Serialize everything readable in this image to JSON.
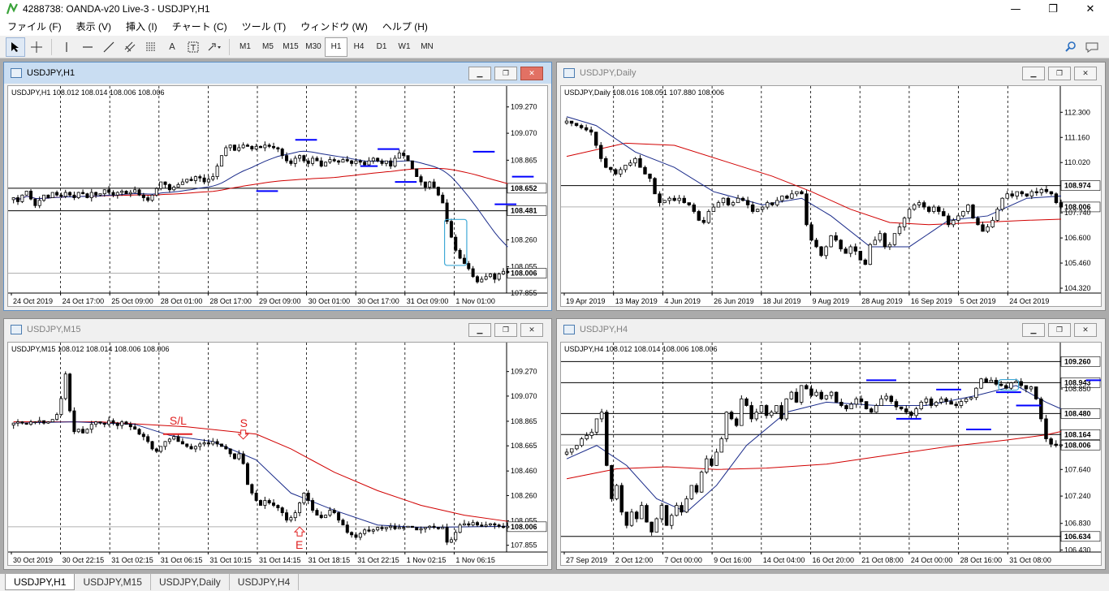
{
  "app": {
    "title": "4288738: OANDA-v20 Live-3 - USDJPY,H1",
    "controls": [
      "—",
      "❐",
      "✕"
    ]
  },
  "menu": [
    "ファイル (F)",
    "表示 (V)",
    "挿入 (I)",
    "チャート (C)",
    "ツール (T)",
    "ウィンドウ (W)",
    "ヘルプ (H)"
  ],
  "toolbar": {
    "tool_icons": [
      "cursor-icon",
      "crosshair-icon",
      "vertical-line-icon",
      "horizontal-line-icon",
      "trendline-icon",
      "fibonacci-icon",
      "channel-icon",
      "text-icon",
      "text-label-icon",
      "arrow-object-icon"
    ],
    "text_tool": "A",
    "label_tool": "T",
    "timeframes": [
      "M1",
      "M5",
      "M15",
      "M30",
      "H1",
      "H4",
      "D1",
      "W1",
      "MN"
    ],
    "selected_timeframe": "H1"
  },
  "colors": {
    "bull": "#ffffff",
    "bear": "#000000",
    "ma_fast": "#1a2b8a",
    "ma_slow": "#d10000",
    "level": "#0000ff",
    "cyan": "#3fa9d6",
    "annotation": "#e02020"
  },
  "windows": [
    {
      "key": "h1",
      "title": "USDJPY,H1",
      "ohlc": "USDJPY,H1  108.012 108.014 108.006 108.006",
      "active": true,
      "chart_data": {
        "type": "candlestick",
        "ylim": [
          107.855,
          109.33
        ],
        "y_ticks": [
          "109.270",
          "109.070",
          "108.865",
          "108.652",
          "108.481",
          "108.260",
          "108.055",
          "108.006",
          "107.855"
        ],
        "highlight_labels": [
          "108.652",
          "108.481",
          "108.006"
        ],
        "x_labels": [
          "24 Oct 2019",
          "24 Oct 17:00",
          "25 Oct 09:00",
          "28 Oct 01:00",
          "28 Oct 17:00",
          "29 Oct 09:00",
          "30 Oct 01:00",
          "30 Oct 17:00",
          "31 Oct 09:00",
          "1 Nov 01:00"
        ],
        "hlines": [
          108.652,
          108.481
        ],
        "last_price": 108.006,
        "closes": [
          108.58,
          108.55,
          108.6,
          108.63,
          108.57,
          108.52,
          108.56,
          108.6,
          108.58,
          108.62,
          108.6,
          108.59,
          108.62,
          108.6,
          108.58,
          108.62,
          108.61,
          108.58,
          108.62,
          108.6,
          108.61,
          108.64,
          108.62,
          108.6,
          108.62,
          108.63,
          108.61,
          108.62,
          108.64,
          108.6,
          108.58,
          108.56,
          108.6,
          108.65,
          108.7,
          108.68,
          108.64,
          108.66,
          108.68,
          108.7,
          108.72,
          108.71,
          108.74,
          108.73,
          108.7,
          108.72,
          108.74,
          108.82,
          108.9,
          108.96,
          108.98,
          108.94,
          108.96,
          108.98,
          108.97,
          108.95,
          108.97,
          108.96,
          108.98,
          108.97,
          108.96,
          108.95,
          108.9,
          108.86,
          108.84,
          108.88,
          108.9,
          108.86,
          108.84,
          108.88,
          108.86,
          108.82,
          108.85,
          108.87,
          108.86,
          108.85,
          108.87,
          108.86,
          108.84,
          108.86,
          108.85,
          108.83,
          108.86,
          108.88,
          108.86,
          108.84,
          108.86,
          108.82,
          108.88,
          108.92,
          108.9,
          108.86,
          108.8,
          108.74,
          108.7,
          108.66,
          108.7,
          108.66,
          108.6,
          108.54,
          108.4,
          108.28,
          108.18,
          108.12,
          108.08,
          108.04,
          107.98,
          107.94,
          107.96,
          107.98,
          108.0,
          107.96,
          108.0,
          108.02,
          108.01
        ],
        "levels": [
          {
            "y": 108.63,
            "i0": 56,
            "i1": 61
          },
          {
            "y": 109.02,
            "i0": 65,
            "i1": 70
          },
          {
            "y": 108.82,
            "i0": 80,
            "i1": 84
          },
          {
            "y": 108.95,
            "i0": 84,
            "i1": 89
          },
          {
            "y": 108.7,
            "i0": 88,
            "i1": 93
          },
          {
            "y": 108.93,
            "i0": 106,
            "i1": 111
          },
          {
            "y": 108.74,
            "i0": 115,
            "i1": 120
          },
          {
            "y": 108.53,
            "i0": 111,
            "i1": 116
          }
        ]
      }
    },
    {
      "key": "d1",
      "title": "USDJPY,Daily",
      "ohlc": "USDJPY,Daily  108.016 108.051 107.880 108.006",
      "active": false,
      "chart_data": {
        "type": "candlestick",
        "ylim": [
          104.1,
          112.9
        ],
        "y_ticks": [
          "112.300",
          "111.160",
          "110.020",
          "108.974",
          "108.006",
          "107.740",
          "106.600",
          "105.460",
          "104.320"
        ],
        "highlight_labels": [
          "108.974",
          "108.006"
        ],
        "x_labels": [
          "19 Apr 2019",
          "13 May 2019",
          "4 Jun 2019",
          "26 Jun 2019",
          "18 Jul 2019",
          "9 Aug 2019",
          "28 Aug 2019",
          "16 Sep 2019",
          "5 Oct 2019",
          "24 Oct 2019"
        ],
        "hlines": [
          108.974
        ],
        "last_price": 108.006,
        "closes": [
          111.9,
          111.8,
          111.7,
          111.6,
          111.5,
          111.4,
          110.8,
          110.2,
          109.8,
          109.7,
          109.5,
          109.7,
          109.9,
          110.0,
          110.2,
          109.8,
          109.5,
          109.3,
          108.6,
          108.2,
          108.3,
          108.4,
          108.3,
          108.4,
          108.2,
          108.1,
          107.8,
          107.4,
          107.3,
          107.8,
          108.0,
          108.2,
          108.4,
          108.1,
          108.2,
          108.4,
          108.3,
          108.1,
          107.8,
          107.9,
          108.0,
          108.2,
          108.1,
          108.3,
          108.5,
          108.4,
          108.6,
          108.7,
          108.6,
          107.2,
          106.5,
          106.2,
          105.8,
          106.2,
          106.7,
          106.5,
          106.1,
          105.9,
          106.2,
          106.0,
          105.6,
          105.4,
          106.3,
          106.5,
          106.8,
          106.2,
          106.3,
          106.8,
          107.1,
          107.5,
          107.9,
          108.1,
          108.2,
          108.0,
          107.8,
          108.0,
          107.8,
          107.6,
          107.2,
          107.4,
          107.6,
          107.8,
          108.1,
          107.5,
          107.2,
          106.9,
          107.1,
          107.4,
          107.9,
          108.4,
          108.6,
          108.5,
          108.7,
          108.6,
          108.5,
          108.7,
          108.65,
          108.8,
          108.7,
          108.6,
          108.2,
          108.0
        ],
        "ma_fast_pts": [
          [
            0,
            112.1
          ],
          [
            6,
            111.7
          ],
          [
            14,
            110.5
          ],
          [
            22,
            109.8
          ],
          [
            30,
            108.7
          ],
          [
            40,
            108.1
          ],
          [
            48,
            108.4
          ],
          [
            54,
            107.6
          ],
          [
            62,
            106.2
          ],
          [
            70,
            106.2
          ],
          [
            78,
            107.4
          ],
          [
            86,
            107.6
          ],
          [
            94,
            108.4
          ],
          [
            101,
            108.5
          ]
        ],
        "ma_slow_pts": [
          [
            0,
            110.3
          ],
          [
            12,
            110.9
          ],
          [
            22,
            110.8
          ],
          [
            32,
            110.1
          ],
          [
            42,
            109.4
          ],
          [
            50,
            108.7
          ],
          [
            58,
            107.9
          ],
          [
            66,
            107.3
          ],
          [
            74,
            107.2
          ],
          [
            84,
            107.3
          ],
          [
            94,
            107.4
          ],
          [
            101,
            107.45
          ]
        ]
      }
    },
    {
      "key": "m15",
      "title": "USDJPY,M15",
      "ohlc": "USDJPY,M15  108.012 108.014 108.006 108.006",
      "active": false,
      "chart_data": {
        "type": "candlestick",
        "ylim": [
          107.8,
          109.4
        ],
        "y_ticks": [
          "109.270",
          "109.070",
          "108.865",
          "108.665",
          "108.460",
          "108.260",
          "108.055",
          "108.006",
          "107.855"
        ],
        "highlight_labels": [
          "108.006"
        ],
        "x_labels": [
          "30 Oct 2019",
          "30 Oct 22:15",
          "31 Oct 02:15",
          "31 Oct 06:15",
          "31 Oct 10:15",
          "31 Oct 14:15",
          "31 Oct 18:15",
          "31 Oct 22:15",
          "1 Nov 02:15",
          "1 Nov 06:15"
        ],
        "last_price": 108.006,
        "closes": [
          108.85,
          108.86,
          108.85,
          108.84,
          108.86,
          108.86,
          108.87,
          108.85,
          108.86,
          108.88,
          108.92,
          109.05,
          109.25,
          108.95,
          108.78,
          108.8,
          108.77,
          108.8,
          108.84,
          108.86,
          108.85,
          108.84,
          108.87,
          108.85,
          108.83,
          108.86,
          108.84,
          108.82,
          108.8,
          108.76,
          108.74,
          108.7,
          108.64,
          108.62,
          108.66,
          108.7,
          108.72,
          108.74,
          108.7,
          108.68,
          108.66,
          108.64,
          108.66,
          108.68,
          108.69,
          108.68,
          108.7,
          108.68,
          108.66,
          108.64,
          108.6,
          108.56,
          108.6,
          108.52,
          108.35,
          108.28,
          108.22,
          108.18,
          108.22,
          108.2,
          108.18,
          108.16,
          108.12,
          108.06,
          108.08,
          108.12,
          108.2,
          108.28,
          108.22,
          108.14,
          108.1,
          108.08,
          108.1,
          108.14,
          108.12,
          108.06,
          108.02,
          107.96,
          107.94,
          107.92,
          107.95,
          107.98,
          107.97,
          107.98,
          108.0,
          107.99,
          108.0,
          108.01,
          107.99,
          108.0,
          108.0,
          108.01,
          108.0,
          107.98,
          107.99,
          108.0,
          108.01,
          108.0,
          107.99,
          108.0,
          107.88,
          107.9,
          107.96,
          108.02,
          108.03,
          108.02,
          108.04,
          108.02,
          108.01,
          108.02,
          108.03,
          108.02,
          108.01,
          108.0,
          108.01
        ],
        "ma_fast_pts": [
          [
            0,
            108.85
          ],
          [
            14,
            108.86
          ],
          [
            28,
            108.84
          ],
          [
            36,
            108.75
          ],
          [
            46,
            108.7
          ],
          [
            56,
            108.55
          ],
          [
            64,
            108.28
          ],
          [
            74,
            108.14
          ],
          [
            84,
            108.02
          ],
          [
            94,
            108.0
          ],
          [
            114,
            108.01
          ]
        ],
        "ma_slow_pts": [
          [
            0,
            108.86
          ],
          [
            20,
            108.86
          ],
          [
            40,
            108.82
          ],
          [
            56,
            108.76
          ],
          [
            64,
            108.64
          ],
          [
            74,
            108.45
          ],
          [
            84,
            108.3
          ],
          [
            94,
            108.18
          ],
          [
            104,
            108.1
          ],
          [
            114,
            108.05
          ]
        ],
        "sl_label": "S/L",
        "s_label": "S",
        "e_label": "E",
        "annotation_pos": {
          "sl_i": 36,
          "s_i": 53,
          "e_i": 66
        },
        "sl_y": 108.8,
        "s_y": 108.74,
        "e_y": 108.05
      }
    },
    {
      "key": "h4",
      "title": "USDJPY,H4",
      "ohlc": "USDJPY,H4  108.012 108.014 108.006 108.006",
      "active": false,
      "chart_data": {
        "type": "candlestick",
        "ylim": [
          106.4,
          109.35
        ],
        "y_ticks": [
          "109.260",
          "108.943",
          "108.850",
          "108.480",
          "108.164",
          "108.006",
          "107.640",
          "107.240",
          "106.830",
          "106.634",
          "106.430"
        ],
        "highlight_labels": [
          "109.260",
          "108.943",
          "108.480",
          "108.164",
          "108.006",
          "106.634"
        ],
        "x_labels": [
          "27 Sep 2019",
          "2 Oct 12:00",
          "7 Oct 00:00",
          "9 Oct 16:00",
          "14 Oct 04:00",
          "16 Oct 20:00",
          "21 Oct 08:00",
          "24 Oct 00:00",
          "28 Oct 16:00",
          "31 Oct 08:00"
        ],
        "hlines": [
          109.26,
          108.943,
          108.48,
          108.164,
          106.634
        ],
        "last_price": 108.006,
        "closes": [
          107.9,
          107.95,
          108.0,
          108.1,
          108.15,
          108.2,
          108.4,
          108.5,
          107.7,
          107.2,
          107.4,
          107.0,
          106.8,
          107.0,
          106.9,
          107.1,
          106.85,
          106.7,
          106.9,
          107.1,
          106.8,
          106.95,
          107.1,
          107.0,
          107.2,
          107.4,
          107.3,
          107.6,
          107.8,
          107.7,
          107.9,
          108.1,
          108.5,
          108.4,
          108.3,
          108.7,
          108.6,
          108.4,
          108.5,
          108.6,
          108.45,
          108.5,
          108.6,
          108.4,
          108.7,
          108.8,
          108.65,
          108.9,
          108.85,
          108.75,
          108.8,
          108.7,
          108.75,
          108.8,
          108.65,
          108.6,
          108.55,
          108.62,
          108.7,
          108.66,
          108.55,
          108.5,
          108.6,
          108.7,
          108.74,
          108.66,
          108.58,
          108.55,
          108.5,
          108.45,
          108.55,
          108.65,
          108.7,
          108.6,
          108.65,
          108.7,
          108.66,
          108.62,
          108.6,
          108.66,
          108.7,
          108.72,
          108.86,
          109.0,
          108.95,
          108.98,
          108.92,
          108.9,
          108.86,
          108.94,
          108.96,
          108.9,
          108.85,
          108.88,
          108.7,
          108.4,
          108.1,
          108.02,
          108.0,
          108.01
        ],
        "ma_fast_pts": [
          [
            0,
            107.8
          ],
          [
            6,
            108.0
          ],
          [
            12,
            107.7
          ],
          [
            18,
            107.2
          ],
          [
            24,
            107.0
          ],
          [
            30,
            107.4
          ],
          [
            36,
            108.0
          ],
          [
            44,
            108.5
          ],
          [
            52,
            108.65
          ],
          [
            62,
            108.6
          ],
          [
            72,
            108.6
          ],
          [
            82,
            108.75
          ],
          [
            90,
            108.9
          ],
          [
            96,
            108.65
          ],
          [
            99,
            108.55
          ]
        ],
        "ma_slow_pts": [
          [
            0,
            107.5
          ],
          [
            10,
            107.65
          ],
          [
            20,
            107.68
          ],
          [
            30,
            107.64
          ],
          [
            40,
            107.66
          ],
          [
            52,
            107.72
          ],
          [
            64,
            107.85
          ],
          [
            76,
            107.98
          ],
          [
            88,
            108.08
          ],
          [
            96,
            108.16
          ],
          [
            99,
            108.21
          ]
        ],
        "levels": [
          {
            "y": 108.98,
            "i0": 60,
            "i1": 66
          },
          {
            "y": 108.4,
            "i0": 66,
            "i1": 71
          },
          {
            "y": 108.84,
            "i0": 74,
            "i1": 79
          },
          {
            "y": 108.24,
            "i0": 80,
            "i1": 85
          },
          {
            "y": 108.8,
            "i0": 86,
            "i1": 91
          },
          {
            "y": 108.6,
            "i0": 90,
            "i1": 95
          },
          {
            "y": 108.98,
            "i0": 104,
            "i1": 110
          },
          {
            "y": 108.86,
            "i0": 107,
            "i1": 112
          },
          {
            "y": 109.1,
            "i0": 114,
            "i1": 120
          }
        ]
      }
    }
  ],
  "tabs": [
    "USDJPY,H1",
    "USDJPY,M15",
    "USDJPY,Daily",
    "USDJPY,H4"
  ]
}
